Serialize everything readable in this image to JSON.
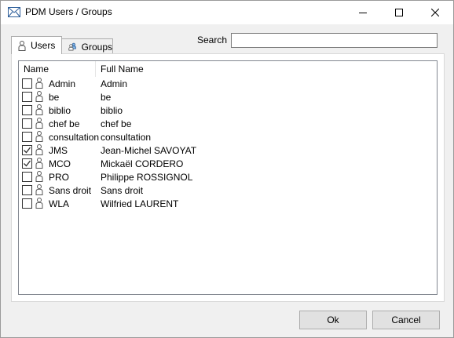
{
  "window": {
    "title": "PDM Users / Groups",
    "icons": {
      "app": "envelope-icon",
      "minimize": "minimize-icon",
      "maximize": "maximize-icon",
      "close": "close-icon"
    }
  },
  "tabs": [
    {
      "label": "Users",
      "icon": "user-icon",
      "active": true
    },
    {
      "label": "Groups",
      "icon": "group-icon",
      "active": false
    }
  ],
  "search": {
    "label": "Search",
    "value": ""
  },
  "list": {
    "columns": [
      "Name",
      "Full Name"
    ],
    "rows": [
      {
        "name": "Admin",
        "full_name": "Admin",
        "checked": false
      },
      {
        "name": "be",
        "full_name": "be",
        "checked": false
      },
      {
        "name": "biblio",
        "full_name": "biblio",
        "checked": false
      },
      {
        "name": "chef be",
        "full_name": "chef be",
        "checked": false
      },
      {
        "name": "consultation",
        "full_name": "consultation",
        "checked": false
      },
      {
        "name": "JMS",
        "full_name": "Jean-Michel SAVOYAT",
        "checked": true
      },
      {
        "name": "MCO",
        "full_name": "Mickaël CORDERO",
        "checked": true
      },
      {
        "name": "PRO",
        "full_name": "Philippe ROSSIGNOL",
        "checked": false
      },
      {
        "name": "Sans droit",
        "full_name": "Sans droit",
        "checked": false
      },
      {
        "name": "WLA",
        "full_name": "Wilfried LAURENT",
        "checked": false
      }
    ]
  },
  "buttons": {
    "ok": "Ok",
    "cancel": "Cancel"
  },
  "colors": {
    "window_bg": "#f0f0f0",
    "button_bg": "#e1e1e1",
    "check": "#333333"
  }
}
